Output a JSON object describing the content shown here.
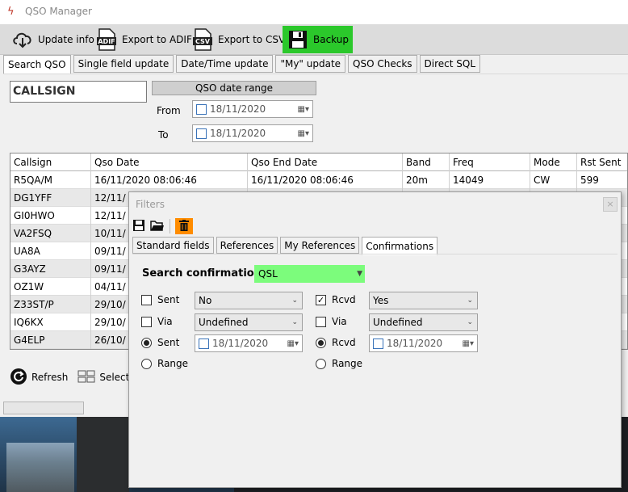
{
  "window": {
    "title": "QSO Manager"
  },
  "toolbar": {
    "update_info": "Update info",
    "export_adif": "Export to ADIF",
    "export_csv": "Export to CSV",
    "backup": "Backup",
    "adif_icon_text": "ADIF",
    "csv_icon_text": "CSV"
  },
  "tabs": [
    "Search QSO",
    "Single field update",
    "Date/Time update",
    "\"My\" update",
    "QSO Checks",
    "Direct SQL"
  ],
  "search": {
    "callsign_label": "CALLSIGN",
    "date_range_header": "QSO date range",
    "from_label": "From",
    "to_label": "To",
    "from_date": "18/11/2020",
    "to_date": "18/11/2020"
  },
  "grid": {
    "columns": [
      "Callsign",
      "Qso Date",
      "Qso End Date",
      "Band",
      "Freq",
      "Mode",
      "Rst Sent"
    ],
    "rows": [
      [
        "R5QA/M",
        "16/11/2020 08:06:46",
        "16/11/2020 08:06:46",
        "20m",
        "14049",
        "CW",
        "599"
      ],
      [
        "DG1YFF",
        "12/11/",
        "",
        "",
        "",
        "",
        ""
      ],
      [
        "GI0HWO",
        "12/11/",
        "",
        "",
        "",
        "",
        ""
      ],
      [
        "VA2FSQ",
        "10/11/",
        "",
        "",
        "",
        "",
        ""
      ],
      [
        "UA8A",
        "09/11/",
        "",
        "",
        "",
        "",
        ""
      ],
      [
        "G3AYZ",
        "09/11/",
        "",
        "",
        "",
        "",
        ""
      ],
      [
        "OZ1W",
        "04/11/",
        "",
        "",
        "",
        "",
        ""
      ],
      [
        "Z33ST/P",
        "29/10/",
        "",
        "",
        "",
        "",
        ""
      ],
      [
        "IQ6KX",
        "29/10/",
        "",
        "",
        "",
        "",
        ""
      ],
      [
        "G4ELP",
        "26/10/",
        "",
        "",
        "",
        "",
        ""
      ]
    ],
    "refresh_label": "Refresh",
    "select_label": "Select/"
  },
  "filters": {
    "title": "Filters",
    "close_glyph": "×",
    "tabs": [
      "Standard fields",
      "References",
      "My References",
      "Confirmations"
    ],
    "search_confirmation_label": "Search confirmation",
    "search_confirmation_value": "QSL",
    "sent_label": "Sent",
    "sent_value": "No",
    "rcvd_label": "Rcvd",
    "rcvd_value": "Yes",
    "via_label": "Via",
    "sent_via_value": "Undefined",
    "rcvd_via_value": "Undefined",
    "sent_radio_label": "Sent",
    "rcvd_radio_label": "Rcvd",
    "sent_date": "18/11/2020",
    "rcvd_date": "18/11/2020",
    "range_label": "Range",
    "check_glyph": "✓"
  },
  "colors": {
    "backup_bg": "#2bc82b",
    "qsl_green": "#7cfc7c",
    "trash_orange": "#ff8c00"
  }
}
